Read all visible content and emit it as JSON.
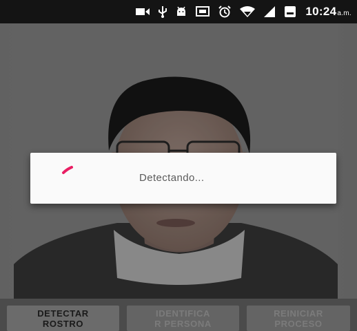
{
  "status_bar": {
    "time": "10:24",
    "time_suffix": "a.m.",
    "icons": [
      "video-camera-icon",
      "usb-icon",
      "android-icon",
      "cast-icon",
      "alarm-icon",
      "wifi-icon",
      "signal-icon",
      "battery-icon"
    ]
  },
  "dialog": {
    "message": "Detectando..."
  },
  "buttons": {
    "detect_label": "DETECTAR\nROSTRO",
    "identify_label": "IDENTIFICA\nR PERSONA",
    "restart_label": "REINICIAR\nPROCESO"
  },
  "colors": {
    "spinner": "#e91e63",
    "dialog_bg": "#fafafa",
    "status_bar_bg": "#141414"
  }
}
